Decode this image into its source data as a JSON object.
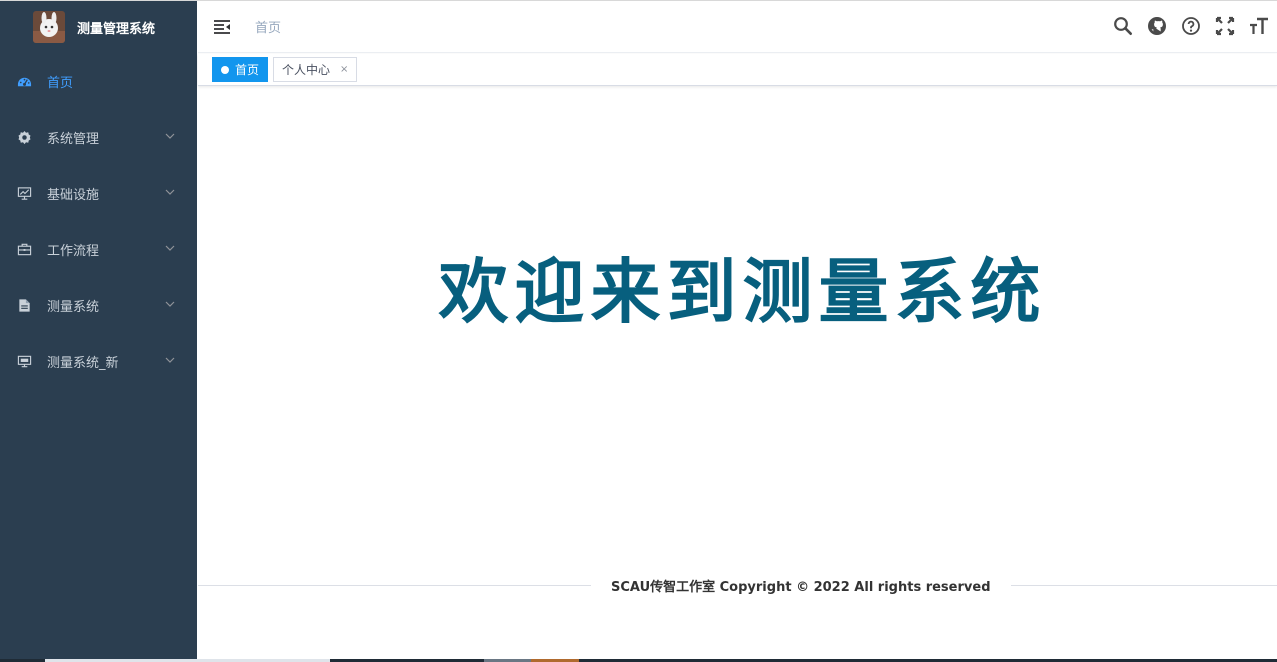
{
  "app": {
    "title": "测量管理系统"
  },
  "sidebar": {
    "items": [
      {
        "label": "首页",
        "icon": "dashboard-icon",
        "active": true
      },
      {
        "label": "系统管理",
        "icon": "gear-icon",
        "expandable": true
      },
      {
        "label": "基础设施",
        "icon": "monitor-chart-icon",
        "expandable": true
      },
      {
        "label": "工作流程",
        "icon": "briefcase-icon",
        "expandable": true
      },
      {
        "label": "测量系统",
        "icon": "document-icon",
        "expandable": true
      },
      {
        "label": "测量系统_新",
        "icon": "display-icon",
        "expandable": true
      }
    ]
  },
  "header": {
    "breadcrumb": "首页",
    "tools": [
      "search-icon",
      "github-icon",
      "help-icon",
      "fullscreen-icon",
      "font-size-icon"
    ]
  },
  "tags": [
    {
      "label": "首页",
      "active": true
    },
    {
      "label": "个人中心",
      "active": false,
      "close": "×"
    }
  ],
  "main": {
    "welcome": "欢迎来到测量系统"
  },
  "footer": {
    "text": "SCAU传智工作室 Copyright © 2022 All rights reserved"
  },
  "colors": {
    "sidebar_bg": "#2b3e50",
    "active_menu": "#409eff",
    "active_tag": "#1296ee",
    "welcome_text": "#075f7e"
  }
}
